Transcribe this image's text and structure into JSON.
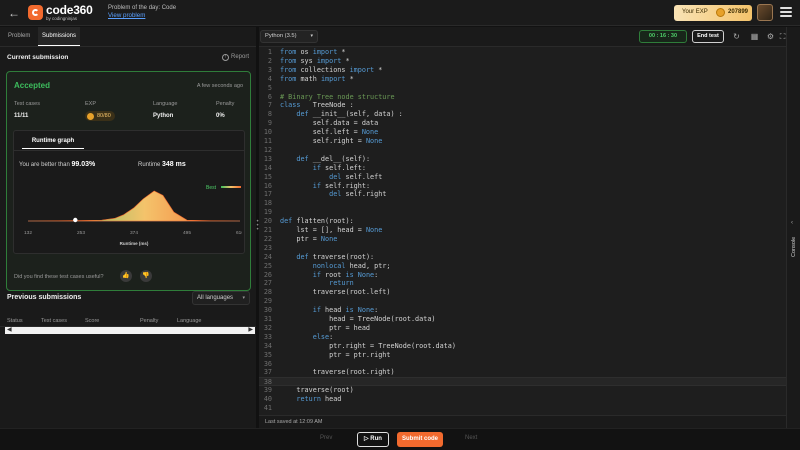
{
  "header": {
    "back_icon": "arrow-left-icon",
    "logo_text": "code360",
    "logo_sub": "by codingninjas",
    "potd_title": "Problem of the day: Code",
    "potd_link": "View problem",
    "exp_label": "Your EXP",
    "exp_value": "207899",
    "menu_icon": "hamburger-icon"
  },
  "left": {
    "tabs": [
      "Problem",
      "Submissions"
    ],
    "active_tab": "Submissions",
    "current_title": "Current submission",
    "report_label": "Report",
    "status": "Accepted",
    "status_color": "#3dbd5d",
    "time_ago": "A few seconds ago",
    "stats": {
      "test_cases_label": "Test cases",
      "test_cases": "11/11",
      "exp_label": "EXP",
      "exp": "80/80",
      "language_label": "Language",
      "language": "Python",
      "penalty_label": "Penalty",
      "penalty": "0%"
    },
    "graph_tab": "Runtime graph",
    "better_prefix": "You are better than",
    "better_value": "99.03%",
    "runtime_prefix": "Runtime",
    "runtime_value": "348 ms",
    "useful_text": "Did you find these test cases useful?",
    "prev_title": "Previous submissions",
    "lang_filter": "All languages",
    "table_headers": [
      "Status",
      "Test cases",
      "Score",
      "Penalty",
      "Language"
    ]
  },
  "chart_data": {
    "type": "area",
    "xlabel": "Runtime (ms)",
    "x_ticks": [
      "132",
      "253",
      "374",
      "495",
      "616"
    ],
    "xlim": [
      132,
      616
    ],
    "x": [
      132,
      200,
      253,
      300,
      330,
      350,
      374,
      395,
      420,
      440,
      465,
      495,
      550,
      616
    ],
    "y": [
      0,
      0.4,
      1,
      2,
      6,
      14,
      30,
      50,
      68,
      58,
      20,
      2,
      0.5,
      0
    ],
    "marker_x": 240,
    "legend": "Best",
    "gradient": [
      "#3dbd5d",
      "#f4c36b",
      "#f26a2e"
    ]
  },
  "editor": {
    "language": "Python (3.5)",
    "timer": "00 : 16 : 30",
    "end_test": "End test",
    "current_line": 38,
    "saved_text": "Last saved at 12:09 AM",
    "lines": [
      [
        {
          "t": "from ",
          "c": "k"
        },
        {
          "t": "os "
        },
        {
          "t": "import ",
          "c": "k"
        },
        {
          "t": "*"
        }
      ],
      [
        {
          "t": "from ",
          "c": "k"
        },
        {
          "t": "sys "
        },
        {
          "t": "import ",
          "c": "k"
        },
        {
          "t": "*"
        }
      ],
      [
        {
          "t": "from ",
          "c": "k"
        },
        {
          "t": "collections "
        },
        {
          "t": "import ",
          "c": "k"
        },
        {
          "t": "*"
        }
      ],
      [
        {
          "t": "from ",
          "c": "k"
        },
        {
          "t": "math "
        },
        {
          "t": "import ",
          "c": "k"
        },
        {
          "t": "*"
        }
      ],
      [],
      [
        {
          "t": "# Binary Tree node structure",
          "c": "c"
        }
      ],
      [
        {
          "t": "class ",
          "c": "k"
        },
        {
          "t": "  TreeNode :"
        }
      ],
      [
        {
          "t": "    "
        },
        {
          "t": "def ",
          "c": "k"
        },
        {
          "t": "__init__(self, data) :"
        }
      ],
      [
        {
          "t": "        self.data = data"
        }
      ],
      [
        {
          "t": "        self.left = "
        },
        {
          "t": "None",
          "c": "k"
        }
      ],
      [
        {
          "t": "        self.right = "
        },
        {
          "t": "None",
          "c": "k"
        }
      ],
      [],
      [
        {
          "t": "    "
        },
        {
          "t": "def ",
          "c": "k"
        },
        {
          "t": "__del__(self):"
        }
      ],
      [
        {
          "t": "        "
        },
        {
          "t": "if ",
          "c": "k"
        },
        {
          "t": "self.left:"
        }
      ],
      [
        {
          "t": "            "
        },
        {
          "t": "del ",
          "c": "k"
        },
        {
          "t": "self.left"
        }
      ],
      [
        {
          "t": "        "
        },
        {
          "t": "if ",
          "c": "k"
        },
        {
          "t": "self.right:"
        }
      ],
      [
        {
          "t": "            "
        },
        {
          "t": "del ",
          "c": "k"
        },
        {
          "t": "self.right"
        }
      ],
      [],
      [],
      [
        {
          "t": "def ",
          "c": "k"
        },
        {
          "t": "flatten(root):"
        }
      ],
      [
        {
          "t": "    lst = [], head = "
        },
        {
          "t": "None",
          "c": "k"
        }
      ],
      [
        {
          "t": "    ptr = "
        },
        {
          "t": "None",
          "c": "k"
        }
      ],
      [],
      [
        {
          "t": "    "
        },
        {
          "t": "def ",
          "c": "k"
        },
        {
          "t": "traverse(root):"
        }
      ],
      [
        {
          "t": "        "
        },
        {
          "t": "nonlocal ",
          "c": "k"
        },
        {
          "t": "head, ptr;"
        }
      ],
      [
        {
          "t": "        "
        },
        {
          "t": "if ",
          "c": "k"
        },
        {
          "t": "root "
        },
        {
          "t": "is None",
          "c": "k"
        },
        {
          "t": ":"
        }
      ],
      [
        {
          "t": "            "
        },
        {
          "t": "return",
          "c": "k"
        }
      ],
      [
        {
          "t": "        traverse(root.left)"
        }
      ],
      [],
      [
        {
          "t": "        "
        },
        {
          "t": "if ",
          "c": "k"
        },
        {
          "t": "head "
        },
        {
          "t": "is None",
          "c": "k"
        },
        {
          "t": ":"
        }
      ],
      [
        {
          "t": "            head = TreeNode(root.data)"
        }
      ],
      [
        {
          "t": "            ptr = head"
        }
      ],
      [
        {
          "t": "        "
        },
        {
          "t": "else",
          "c": "k"
        },
        {
          "t": ":"
        }
      ],
      [
        {
          "t": "            ptr.right = TreeNode(root.data)"
        }
      ],
      [
        {
          "t": "            ptr = ptr.right"
        }
      ],
      [],
      [
        {
          "t": "        traverse(root.right)"
        }
      ],
      [],
      [
        {
          "t": "    traverse(root)"
        }
      ],
      [
        {
          "t": "    "
        },
        {
          "t": "return ",
          "c": "k"
        },
        {
          "t": "head"
        }
      ],
      []
    ]
  },
  "console_label": "Console",
  "bottom": {
    "prev": "Prev",
    "run": "Run",
    "submit": "Submit code",
    "submit_color": "#f26a2e",
    "next": "Next"
  }
}
